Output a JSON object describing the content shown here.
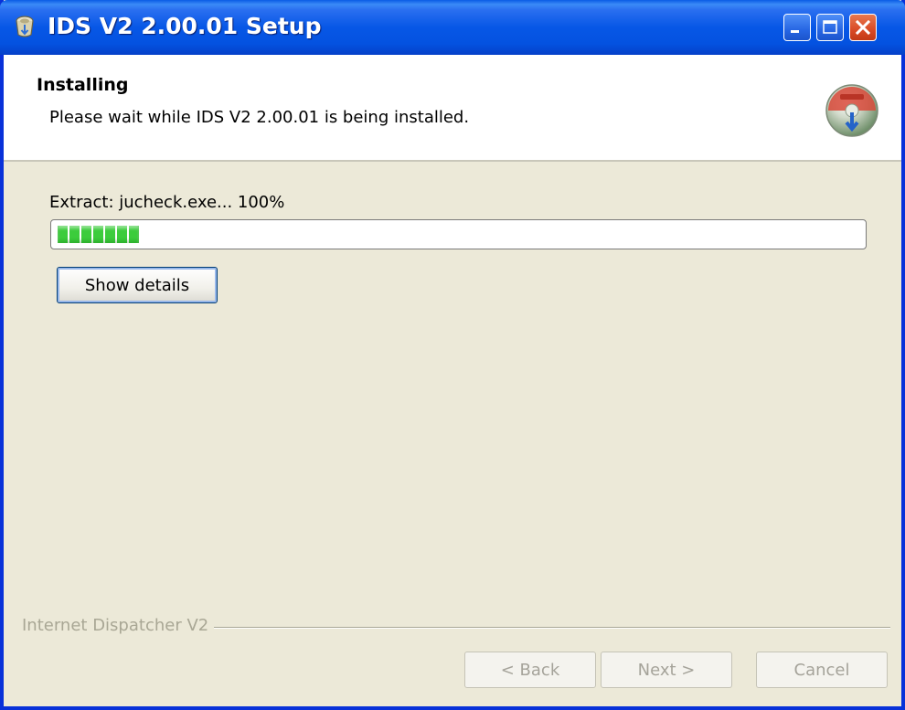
{
  "window": {
    "title": "IDS V2 2.00.01 Setup",
    "controls": [
      "minimize",
      "maximize",
      "close"
    ]
  },
  "header": {
    "title": "Installing",
    "subtitle": "Please wait while IDS V2 2.00.01 is being installed.",
    "icon": "installer-disk-icon"
  },
  "progress": {
    "status_text": "Extract: jucheck.exe... 100%",
    "fraction": 0.1,
    "color": "#3ccc3c"
  },
  "details_button": {
    "label": "Show details"
  },
  "footer": {
    "brand": "Internet Dispatcher V2",
    "back_label": "< Back",
    "next_label": "Next >",
    "cancel_label": "Cancel"
  },
  "colors": {
    "titlebar": "#0757e6",
    "close_button": "#d94a25",
    "window_background": "#ece9d8"
  }
}
